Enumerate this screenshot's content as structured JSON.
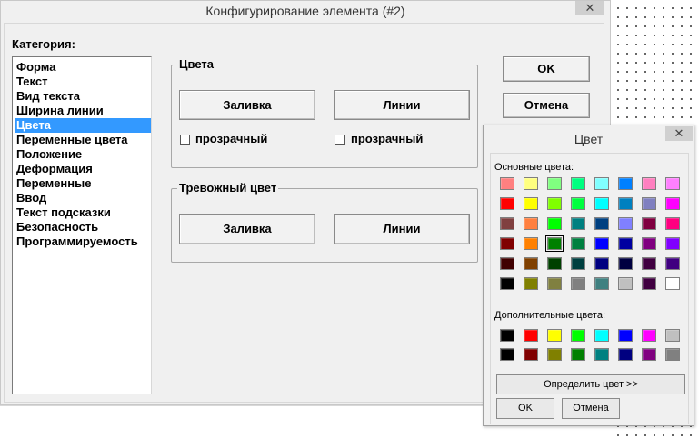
{
  "dialog": {
    "title": "Конфигурирование элемента (#2)",
    "close": "✕",
    "category_label": "Категория:",
    "categories": [
      "Форма",
      "Текст",
      "Вид текста",
      "Ширина линии",
      "Цвета",
      "Переменные цвета",
      "Положение",
      "Деформация",
      "Переменные",
      "Ввод",
      "Текст подсказки",
      "Безопасность",
      "Программируемость"
    ],
    "selected_category_index": 4,
    "colors_group": {
      "title": "Цвета",
      "fill_button": "Заливка",
      "lines_button": "Линии",
      "transparent_fill": "прозрачный",
      "transparent_lines": "прозрачный"
    },
    "alarm_group": {
      "title": "Тревожный цвет",
      "fill_button": "Заливка",
      "lines_button": "Линии"
    },
    "ok_button": "OK",
    "cancel_button": "Отмена"
  },
  "color_dialog": {
    "title": "Цвет",
    "close": "✕",
    "basic_label": "Основные цвета:",
    "custom_label": "Дополнительные цвета:",
    "define_button": "Определить цвет >>",
    "ok_button": "OK",
    "cancel_button": "Отмена",
    "selected_basic": [
      3,
      2
    ],
    "basic_colors": [
      [
        "#ff8080",
        "#ffff80",
        "#80ff80",
        "#00ff80",
        "#80ffff",
        "#0080ff",
        "#ff80c0",
        "#ff80ff"
      ],
      [
        "#ff0000",
        "#ffff00",
        "#80ff00",
        "#00ff40",
        "#00ffff",
        "#0080c0",
        "#8080c0",
        "#ff00ff"
      ],
      [
        "#804040",
        "#ff8040",
        "#00ff00",
        "#008080",
        "#004080",
        "#8080ff",
        "#800040",
        "#ff0080"
      ],
      [
        "#800000",
        "#ff8000",
        "#008000",
        "#008040",
        "#0000ff",
        "#0000a0",
        "#800080",
        "#8000ff"
      ],
      [
        "#400000",
        "#804000",
        "#004000",
        "#004040",
        "#000080",
        "#000040",
        "#400040",
        "#400080"
      ],
      [
        "#000000",
        "#808000",
        "#808040",
        "#808080",
        "#408080",
        "#c0c0c0",
        "#400040",
        "#ffffff"
      ]
    ],
    "custom_colors": [
      [
        "#000000",
        "#ff0000",
        "#ffff00",
        "#00ff00",
        "#00ffff",
        "#0000ff",
        "#ff00ff",
        "#c0c0c0"
      ],
      [
        "#000000",
        "#800000",
        "#808000",
        "#008000",
        "#008080",
        "#000080",
        "#800080",
        "#808080"
      ]
    ]
  }
}
